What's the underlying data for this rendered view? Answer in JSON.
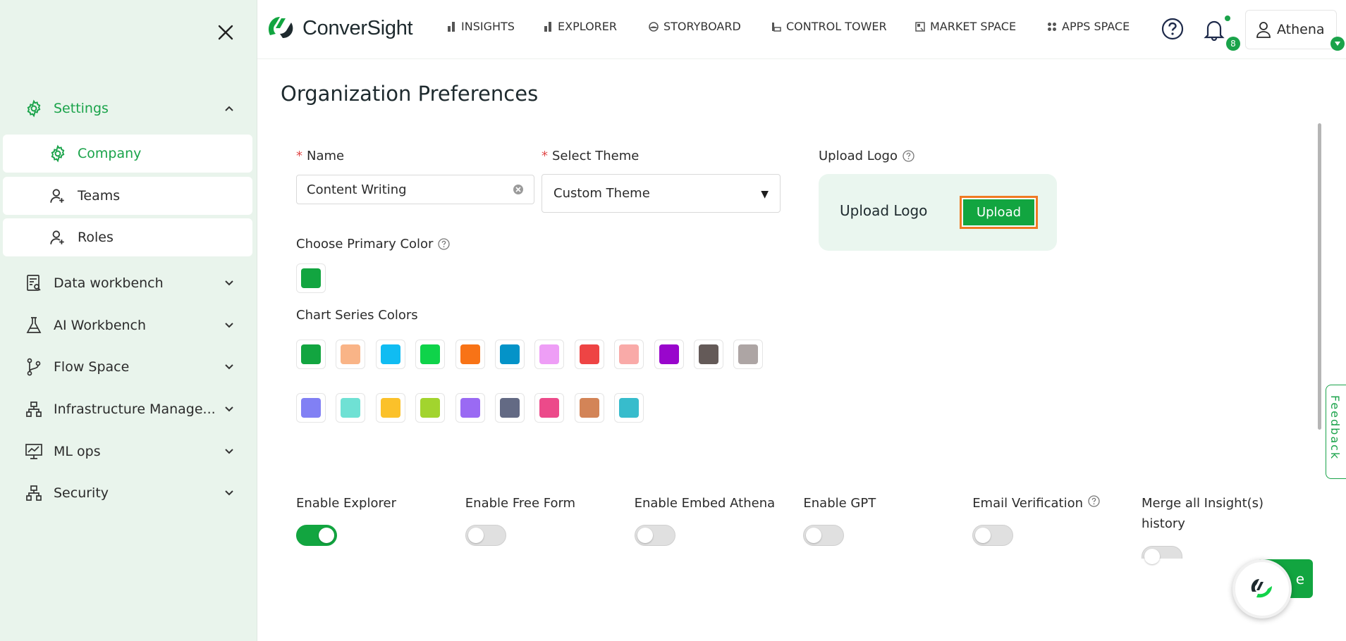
{
  "brand": {
    "name": "ConverSight",
    "accent": "#1aa34a",
    "primary_button": "#12a540"
  },
  "sidebar": {
    "settings": {
      "label": "Settings",
      "icon": "gear-icon"
    },
    "sub_items": [
      {
        "label": "Company",
        "icon": "gear-icon",
        "active": true
      },
      {
        "label": "Teams",
        "icon": "user-group-icon"
      },
      {
        "label": "Roles",
        "icon": "user-role-icon"
      }
    ],
    "items": [
      {
        "label": "Data workbench",
        "icon": "data-workbench-icon"
      },
      {
        "label": "AI Workbench",
        "icon": "flask-icon"
      },
      {
        "label": "Flow Space",
        "icon": "branch-icon"
      },
      {
        "label": "Infrastructure Manage...",
        "icon": "network-icon"
      },
      {
        "label": "ML ops",
        "icon": "presentation-chart-icon"
      },
      {
        "label": "Security",
        "icon": "network-icon"
      }
    ]
  },
  "topnav": [
    {
      "label": "INSIGHTS",
      "icon": "bar-chart-icon"
    },
    {
      "label": "EXPLORER",
      "icon": "bar-chart-icon"
    },
    {
      "label": "STORYBOARD",
      "icon": "storyboard-icon"
    },
    {
      "label": "CONTROL TOWER",
      "icon": "tower-icon"
    },
    {
      "label": "MARKET SPACE",
      "icon": "market-icon"
    },
    {
      "label": "APPS SPACE",
      "icon": "apps-icon"
    }
  ],
  "header": {
    "notifications_count": "8",
    "user_name": "Athena"
  },
  "page": {
    "title": "Organization Preferences",
    "name_label": "Name",
    "name_value": "Content Writing",
    "theme_label": "Select Theme",
    "theme_value": "Custom Theme",
    "upload_label": "Upload Logo",
    "upload_box_text": "Upload Logo",
    "upload_button": "Upload",
    "primary_color_label": "Choose Primary Color",
    "primary_color": "#12a540",
    "series_label": "Chart Series Colors",
    "series_colors_row1": [
      "#12a540",
      "#f9b487",
      "#10bcf2",
      "#0fd34a",
      "#f87316",
      "#0493c8",
      "#ee9ef6",
      "#ee4444",
      "#f9aaa8",
      "#9906cc",
      "#645a58",
      "#ada5a4"
    ],
    "series_colors_row2": [
      "#8180f4",
      "#6fe1d4",
      "#fbc12a",
      "#a2d42e",
      "#9a6af3",
      "#636a84",
      "#ec4a8a",
      "#d38457",
      "#37bccc"
    ]
  },
  "toggles": [
    {
      "label": "Enable Explorer",
      "on": true
    },
    {
      "label": "Enable Free Form",
      "on": false
    },
    {
      "label": "Enable Embed Athena",
      "on": false
    },
    {
      "label": "Enable GPT",
      "on": false
    },
    {
      "label": "Email Verification",
      "on": false,
      "help": true
    },
    {
      "label": "Merge all Insight(s) history",
      "on": false
    }
  ],
  "feedback_label": "Feedback",
  "save_label": "e"
}
